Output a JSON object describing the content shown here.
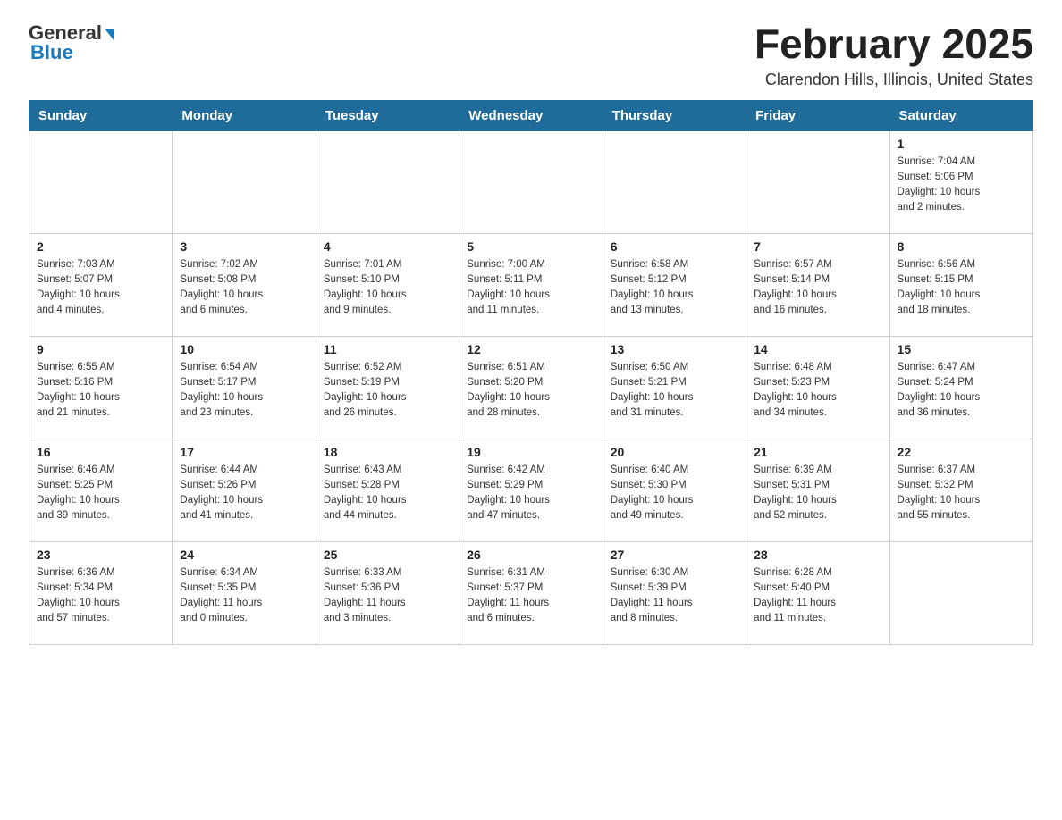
{
  "header": {
    "logo_general": "General",
    "logo_blue": "Blue",
    "month_title": "February 2025",
    "location": "Clarendon Hills, Illinois, United States"
  },
  "weekdays": [
    "Sunday",
    "Monday",
    "Tuesday",
    "Wednesday",
    "Thursday",
    "Friday",
    "Saturday"
  ],
  "weeks": [
    [
      {
        "day": "",
        "info": ""
      },
      {
        "day": "",
        "info": ""
      },
      {
        "day": "",
        "info": ""
      },
      {
        "day": "",
        "info": ""
      },
      {
        "day": "",
        "info": ""
      },
      {
        "day": "",
        "info": ""
      },
      {
        "day": "1",
        "info": "Sunrise: 7:04 AM\nSunset: 5:06 PM\nDaylight: 10 hours\nand 2 minutes."
      }
    ],
    [
      {
        "day": "2",
        "info": "Sunrise: 7:03 AM\nSunset: 5:07 PM\nDaylight: 10 hours\nand 4 minutes."
      },
      {
        "day": "3",
        "info": "Sunrise: 7:02 AM\nSunset: 5:08 PM\nDaylight: 10 hours\nand 6 minutes."
      },
      {
        "day": "4",
        "info": "Sunrise: 7:01 AM\nSunset: 5:10 PM\nDaylight: 10 hours\nand 9 minutes."
      },
      {
        "day": "5",
        "info": "Sunrise: 7:00 AM\nSunset: 5:11 PM\nDaylight: 10 hours\nand 11 minutes."
      },
      {
        "day": "6",
        "info": "Sunrise: 6:58 AM\nSunset: 5:12 PM\nDaylight: 10 hours\nand 13 minutes."
      },
      {
        "day": "7",
        "info": "Sunrise: 6:57 AM\nSunset: 5:14 PM\nDaylight: 10 hours\nand 16 minutes."
      },
      {
        "day": "8",
        "info": "Sunrise: 6:56 AM\nSunset: 5:15 PM\nDaylight: 10 hours\nand 18 minutes."
      }
    ],
    [
      {
        "day": "9",
        "info": "Sunrise: 6:55 AM\nSunset: 5:16 PM\nDaylight: 10 hours\nand 21 minutes."
      },
      {
        "day": "10",
        "info": "Sunrise: 6:54 AM\nSunset: 5:17 PM\nDaylight: 10 hours\nand 23 minutes."
      },
      {
        "day": "11",
        "info": "Sunrise: 6:52 AM\nSunset: 5:19 PM\nDaylight: 10 hours\nand 26 minutes."
      },
      {
        "day": "12",
        "info": "Sunrise: 6:51 AM\nSunset: 5:20 PM\nDaylight: 10 hours\nand 28 minutes."
      },
      {
        "day": "13",
        "info": "Sunrise: 6:50 AM\nSunset: 5:21 PM\nDaylight: 10 hours\nand 31 minutes."
      },
      {
        "day": "14",
        "info": "Sunrise: 6:48 AM\nSunset: 5:23 PM\nDaylight: 10 hours\nand 34 minutes."
      },
      {
        "day": "15",
        "info": "Sunrise: 6:47 AM\nSunset: 5:24 PM\nDaylight: 10 hours\nand 36 minutes."
      }
    ],
    [
      {
        "day": "16",
        "info": "Sunrise: 6:46 AM\nSunset: 5:25 PM\nDaylight: 10 hours\nand 39 minutes."
      },
      {
        "day": "17",
        "info": "Sunrise: 6:44 AM\nSunset: 5:26 PM\nDaylight: 10 hours\nand 41 minutes."
      },
      {
        "day": "18",
        "info": "Sunrise: 6:43 AM\nSunset: 5:28 PM\nDaylight: 10 hours\nand 44 minutes."
      },
      {
        "day": "19",
        "info": "Sunrise: 6:42 AM\nSunset: 5:29 PM\nDaylight: 10 hours\nand 47 minutes."
      },
      {
        "day": "20",
        "info": "Sunrise: 6:40 AM\nSunset: 5:30 PM\nDaylight: 10 hours\nand 49 minutes."
      },
      {
        "day": "21",
        "info": "Sunrise: 6:39 AM\nSunset: 5:31 PM\nDaylight: 10 hours\nand 52 minutes."
      },
      {
        "day": "22",
        "info": "Sunrise: 6:37 AM\nSunset: 5:32 PM\nDaylight: 10 hours\nand 55 minutes."
      }
    ],
    [
      {
        "day": "23",
        "info": "Sunrise: 6:36 AM\nSunset: 5:34 PM\nDaylight: 10 hours\nand 57 minutes."
      },
      {
        "day": "24",
        "info": "Sunrise: 6:34 AM\nSunset: 5:35 PM\nDaylight: 11 hours\nand 0 minutes."
      },
      {
        "day": "25",
        "info": "Sunrise: 6:33 AM\nSunset: 5:36 PM\nDaylight: 11 hours\nand 3 minutes."
      },
      {
        "day": "26",
        "info": "Sunrise: 6:31 AM\nSunset: 5:37 PM\nDaylight: 11 hours\nand 6 minutes."
      },
      {
        "day": "27",
        "info": "Sunrise: 6:30 AM\nSunset: 5:39 PM\nDaylight: 11 hours\nand 8 minutes."
      },
      {
        "day": "28",
        "info": "Sunrise: 6:28 AM\nSunset: 5:40 PM\nDaylight: 11 hours\nand 11 minutes."
      },
      {
        "day": "",
        "info": ""
      }
    ]
  ]
}
